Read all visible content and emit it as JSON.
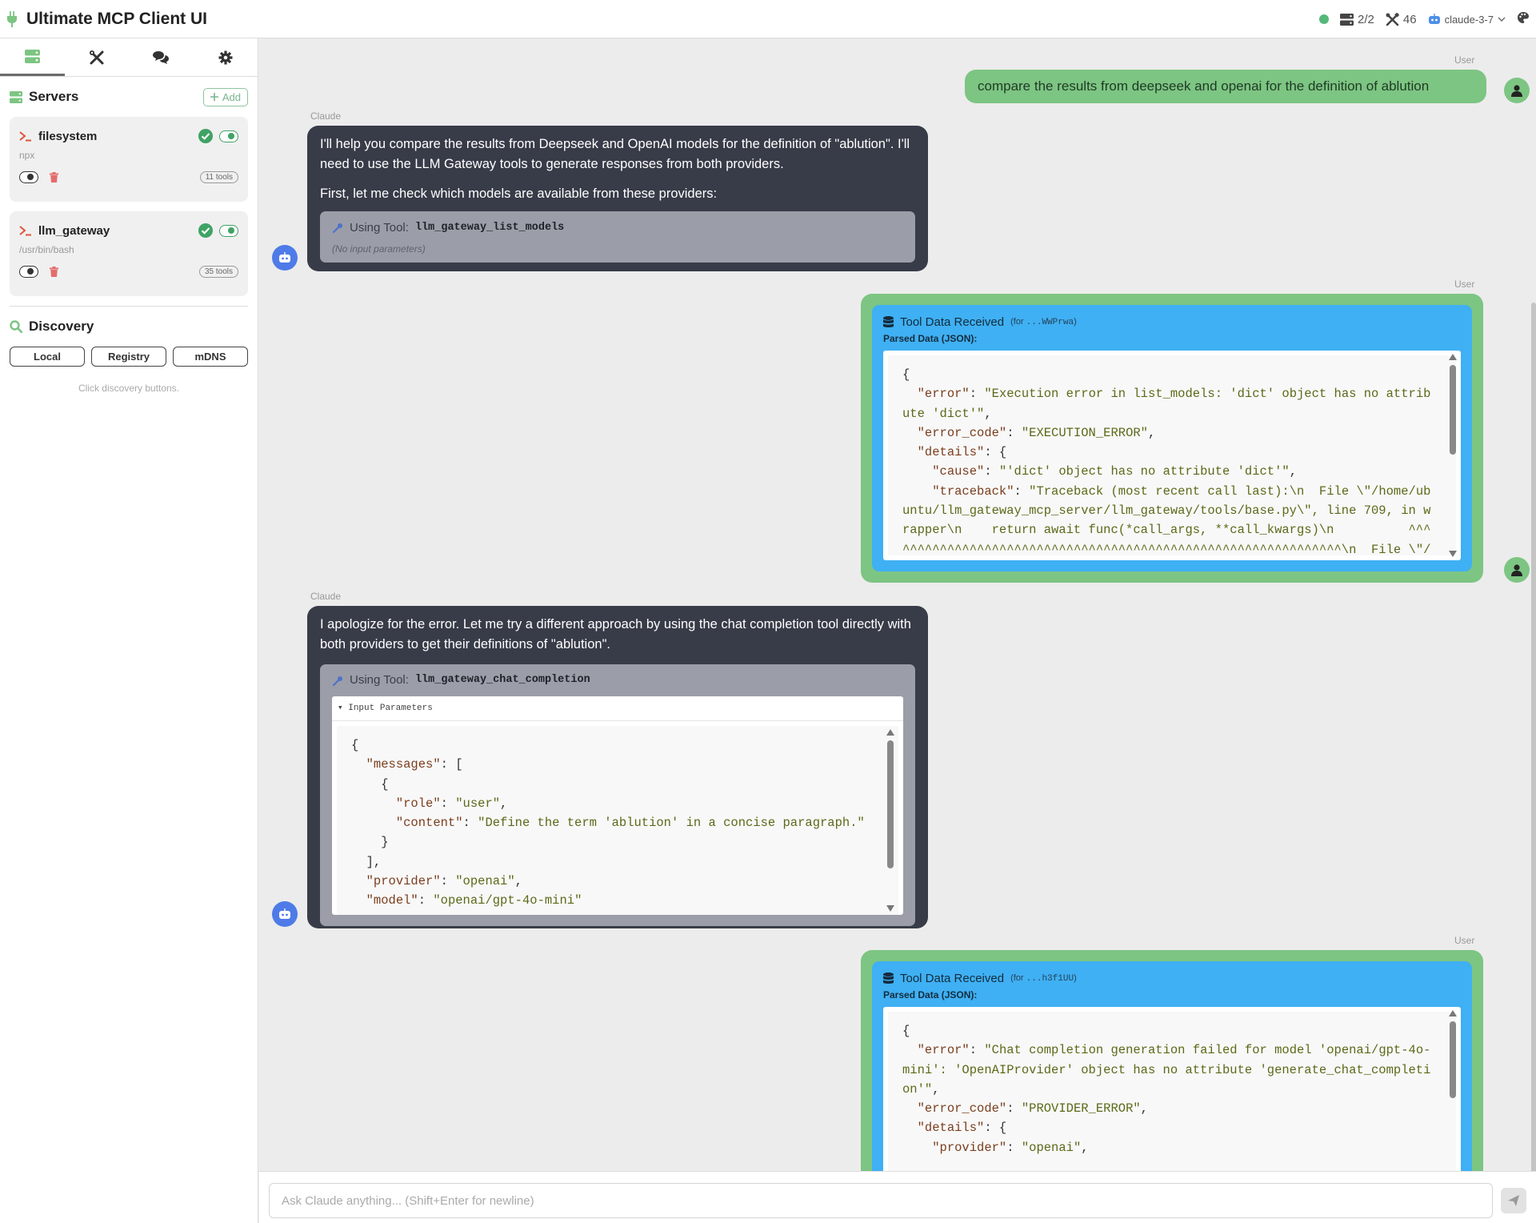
{
  "header": {
    "title": "Ultimate MCP Client UI",
    "servers_count": "2/2",
    "tools_count": "46",
    "model": "claude-3-7"
  },
  "sidebar": {
    "tabs": [
      "servers",
      "tools",
      "chat",
      "settings"
    ],
    "servers_title": "Servers",
    "add_label": "Add",
    "servers": [
      {
        "name": "filesystem",
        "command": "npx",
        "tools": "11 tools"
      },
      {
        "name": "llm_gateway",
        "command": "/usr/bin/bash",
        "tools": "35 tools"
      }
    ],
    "discovery_title": "Discovery",
    "discovery_buttons": [
      "Local",
      "Registry",
      "mDNS"
    ],
    "discovery_hint": "Click discovery buttons."
  },
  "chat": {
    "user_label": "User",
    "claude_label": "Claude",
    "msg1": "compare the results from deepseek and openai for the definition of ablution",
    "msg2_p1": "I'll help you compare the results from Deepseek and OpenAI models for the definition of \"ablution\". I'll need to use the LLM Gateway tools to generate responses from both providers.",
    "msg2_p2": "First, let me check which models are available from these providers:",
    "tool1_using": "Using Tool:",
    "tool1_name": "llm_gateway_list_models",
    "tool1_params": "(No input parameters)",
    "result1_title": "Tool Data Received",
    "result1_for_prefix": "(for ",
    "result1_for_id": "...WWPrwa",
    "result1_for_suffix": ")",
    "result1_parsed": "Parsed Data (JSON):",
    "result1_json": {
      "open": "{",
      "error_key": "\"error\"",
      "error_val": "\"Execution error in list_models: 'dict' object has no attribute 'dict'\"",
      "code_key": "\"error_code\"",
      "code_val": "\"EXECUTION_ERROR\"",
      "details_key": "\"details\"",
      "cause_key": "\"cause\"",
      "cause_val": "\"'dict' object has no attribute 'dict'\"",
      "tb_key": "\"traceback\"",
      "tb_val": "\"Traceback (most recent call last):\\n  File \\\"/home/ubuntu/llm_gateway_mcp_server/llm_gateway/tools/base.py\\\", line 709, in wrapper\\n    return await func(*call_args, **call_kwargs)\\n          ^^^^^^^^",
      "tb_tail": "^^^^^^^^^^^^^^^^^^^^^^^^^^^^^^^^^^^^^^^^^^^^^^^^^^^^^^\\n  File \\\"/home/ubuntu/llm_gateway"
    },
    "msg3_p1": "I apologize for the error. Let me try a different approach by using the chat completion tool directly with both providers to get their definitions of \"ablution\".",
    "tool2_using": "Using Tool:",
    "tool2_name": "llm_gateway_chat_completion",
    "tool2_summary": "Input Parameters",
    "tool2_json": {
      "open": "{",
      "messages_key": "\"messages\"",
      "role_key": "\"role\"",
      "role_val": "\"user\"",
      "content_key": "\"content\"",
      "content_val": "\"Define the term 'ablution' in a concise paragraph.\"",
      "provider_key": "\"provider\"",
      "provider_val": "\"openai\"",
      "model_key": "\"model\"",
      "model_val": "\"openai/gpt-4o-mini\""
    },
    "result2_title": "Tool Data Received",
    "result2_for_prefix": "(for ",
    "result2_for_id": "...h3f1UU",
    "result2_for_suffix": ")",
    "result2_parsed": "Parsed Data (JSON):",
    "result2_json": {
      "open": "{",
      "error_key": "\"error\"",
      "error_val": "\"Chat completion generation failed for model 'openai/gpt-4o-mini': 'OpenAIProvider' object has no attribute 'generate_chat_completion'\"",
      "code_key": "\"error_code\"",
      "code_val": "\"PROVIDER_ERROR\"",
      "details_key": "\"details\"",
      "provider_key": "\"provider\"",
      "provider_val": "\"openai\""
    }
  },
  "input": {
    "placeholder": "Ask Claude anything... (Shift+Enter for newline)"
  },
  "colors": {
    "accent_green": "#7dc583",
    "claude_bubble": "#383c48",
    "tool_result_blue": "#3fb0f3",
    "bot_avatar": "#4e7be8"
  }
}
